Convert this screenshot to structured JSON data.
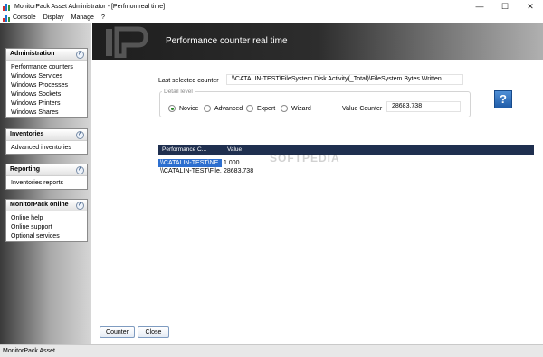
{
  "window": {
    "title": "MonitorPack Asset Administrator - [Perfmon real time]",
    "minimize": "—",
    "maximize": "☐",
    "close": "✕"
  },
  "menu": [
    "Console",
    "Display",
    "Manage",
    "?"
  ],
  "sidebar": {
    "administration": {
      "title": "Administration",
      "items": [
        "Performance counters",
        "Windows Services",
        "Windows Processes",
        "Windows Sockets",
        "Windows Printers",
        "Windows Shares"
      ]
    },
    "inventories": {
      "title": "Inventories",
      "items": [
        "Advanced inventories"
      ]
    },
    "reporting": {
      "title": "Reporting",
      "items": [
        "Inventories reports"
      ]
    },
    "monitorpack_online": {
      "title": "MonitorPack online",
      "items": [
        "Online help",
        "Online support",
        "Optional services"
      ]
    }
  },
  "header": {
    "title": "Performance counter real time"
  },
  "form": {
    "last_selected_label": "Last selected counter",
    "last_selected_value": "\\\\CATALIN-TEST\\FileSystem Disk Activity(_Total)\\FileSystem Bytes Written",
    "detail_level_legend": "Detail level",
    "radios": [
      {
        "label": "Novice",
        "checked": true
      },
      {
        "label": "Advanced",
        "checked": false
      },
      {
        "label": "Expert",
        "checked": false
      },
      {
        "label": "Wizard",
        "checked": false
      }
    ],
    "value_counter_label": "Value Counter",
    "value_counter_value": "28683.738",
    "help": "?"
  },
  "grid": {
    "columns": [
      "Performance C...",
      "Value"
    ],
    "rows": [
      {
        "counter": "\\\\CATALIN-TEST\\NE...",
        "value": "1.000",
        "selected": true
      },
      {
        "counter": "\\\\CATALIN-TEST\\File...",
        "value": "28683.738",
        "selected": false
      }
    ]
  },
  "watermark": "SOFTPEDIA",
  "buttons": {
    "counter": "Counter",
    "close": "Close"
  },
  "status": {
    "text": "MonitorPack Asset"
  }
}
